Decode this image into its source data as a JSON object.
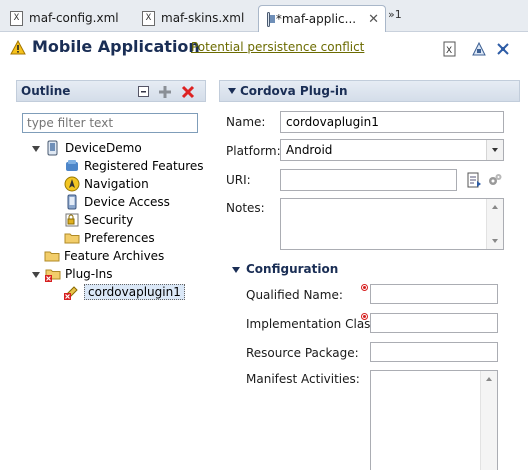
{
  "tabs": [
    {
      "label": "maf-config.xml",
      "active": false
    },
    {
      "label": "maf-skins.xml",
      "active": false
    },
    {
      "label": "*maf-applic...",
      "active": true
    }
  ],
  "tab_overflow": "»1",
  "header": {
    "title": "Mobile Application",
    "warning_link": "Potential persistence conflict"
  },
  "outline": {
    "title": "Outline",
    "filter_placeholder": "type filter text",
    "tree": {
      "root": "DeviceDemo",
      "children": [
        {
          "label": "Registered Features",
          "icon": "features-icon"
        },
        {
          "label": "Navigation",
          "icon": "navigation-icon"
        },
        {
          "label": "Device Access",
          "icon": "device-access-icon"
        },
        {
          "label": "Security",
          "icon": "security-icon"
        },
        {
          "label": "Preferences",
          "icon": "folder-icon"
        }
      ],
      "feature_archives": "Feature Archives",
      "plugins": "Plug-Ins",
      "selected_plugin": "cordovaplugin1"
    }
  },
  "plugin_section": {
    "title": "Cordova Plug-in",
    "name_label": "Name:",
    "name_value": "cordovaplugin1",
    "platform_label": "Platform:",
    "platform_value": "Android",
    "uri_label": "URI:",
    "uri_value": "",
    "notes_label": "Notes:",
    "notes_value": ""
  },
  "configuration": {
    "title": "Configuration",
    "qualified_name_label": "Qualified Name:",
    "implementation_class_label": "Implementation Class:",
    "resource_package_label": "Resource Package:",
    "manifest_activities_label": "Manifest Activities:"
  },
  "colors": {
    "heading": "#1a2e55",
    "required_marker": "#d62020",
    "link": "#6b6b00"
  }
}
